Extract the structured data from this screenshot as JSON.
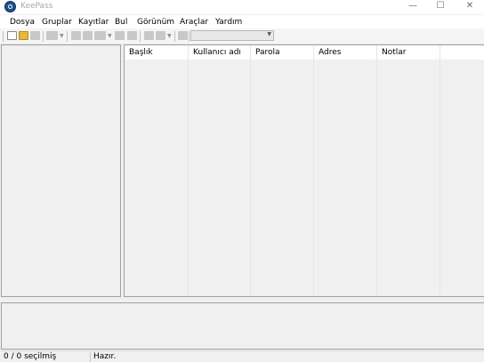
{
  "window": {
    "title": "KeePass",
    "minimize": "—",
    "maximize": "☐",
    "close": "✕"
  },
  "menu": [
    "Dosya",
    "Gruplar",
    "Kayıtlar",
    "Bul",
    "Görünüm",
    "Araçlar",
    "Yardım"
  ],
  "toolbar": {
    "quick_find_value": "",
    "icons": [
      "new-database-icon",
      "open-database-icon",
      "save-icon",
      "sync-icon",
      "add-entry-icon",
      "edit-entry-icon",
      "delete-entry-icon",
      "copy-username-icon",
      "copy-password-icon",
      "find-icon",
      "view-icon",
      "lock-workspace-icon"
    ]
  },
  "entry_list": {
    "columns": [
      "Başlık",
      "Kullanıcı adı",
      "Parola",
      "Adres",
      "Notlar"
    ],
    "rows": []
  },
  "status": {
    "selection": "0 / 0 seçilmiş",
    "message": "Hazır."
  },
  "colors": {
    "title_text": "#a8a8a8",
    "border": "#a0a0a0",
    "panel_bg": "#f0f0f0",
    "header_bg": "#ffffff"
  }
}
